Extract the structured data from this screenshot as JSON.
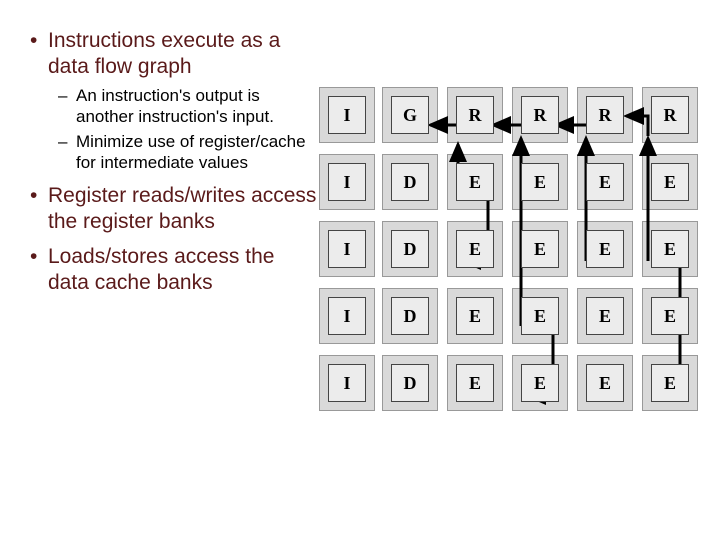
{
  "bullets": {
    "b1": "Instructions execute as a data flow graph",
    "s1": "An instruction's output is another instruction's input.",
    "s2": "Minimize use of register/cache for intermediate values",
    "b2": "Register reads/writes access the register banks",
    "b3": "Loads/stores access the data cache banks"
  },
  "grid": {
    "rows": [
      [
        "I",
        "G",
        "R",
        "R",
        "R",
        "R"
      ],
      [
        "I",
        "D",
        "E",
        "E",
        "E",
        "E"
      ],
      [
        "I",
        "D",
        "E",
        "E",
        "E",
        "E"
      ],
      [
        "I",
        "D",
        "E",
        "E",
        "E",
        "E"
      ],
      [
        "I",
        "D",
        "E",
        "E",
        "E",
        "E"
      ]
    ]
  }
}
